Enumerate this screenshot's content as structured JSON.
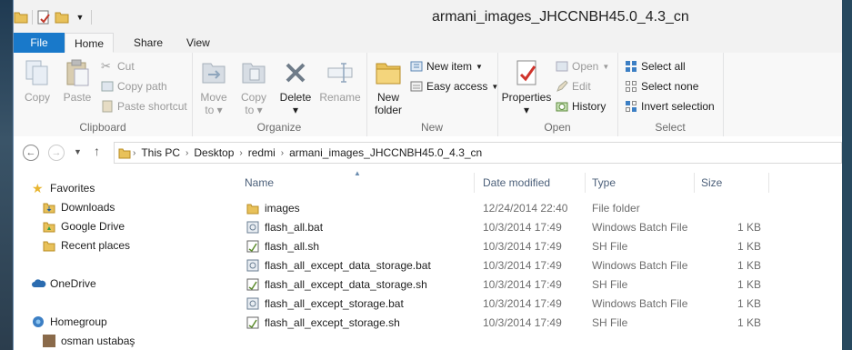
{
  "window": {
    "title": "armani_images_JHCCNBH45.0_4.3_cn"
  },
  "tabs": [
    "File",
    "Home",
    "Share",
    "View"
  ],
  "ribbon": {
    "clipboard": {
      "label": "Clipboard",
      "copy": "Copy",
      "paste": "Paste",
      "cut": "Cut",
      "copy_path": "Copy path",
      "paste_shortcut": "Paste shortcut"
    },
    "organize": {
      "label": "Organize",
      "move_to": "Move",
      "move_to_2": "to",
      "copy_to": "Copy",
      "copy_to_2": "to",
      "delete": "Delete",
      "rename": "Rename"
    },
    "new": {
      "label": "New",
      "new_folder": "New",
      "new_folder_2": "folder",
      "new_item": "New item",
      "easy_access": "Easy access"
    },
    "open": {
      "label": "Open",
      "properties": "Properties",
      "open": "Open",
      "edit": "Edit",
      "history": "History"
    },
    "select": {
      "label": "Select",
      "select_all": "Select all",
      "select_none": "Select none",
      "invert": "Invert selection"
    }
  },
  "address": {
    "crumbs": [
      "This PC",
      "Desktop",
      "redmi",
      "armani_images_JHCCNBH45.0_4.3_cn"
    ]
  },
  "nav": {
    "favorites": "Favorites",
    "downloads": "Downloads",
    "google_drive": "Google Drive",
    "recent": "Recent places",
    "onedrive": "OneDrive",
    "homegroup": "Homegroup",
    "user": "osman ustabaş"
  },
  "columns": {
    "name": "Name",
    "date": "Date modified",
    "type": "Type",
    "size": "Size"
  },
  "files": [
    {
      "name": "images",
      "date": "12/24/2014 22:40",
      "type": "File folder",
      "size": "",
      "icon": "folder-icon"
    },
    {
      "name": "flash_all.bat",
      "date": "10/3/2014 17:49",
      "type": "Windows Batch File",
      "size": "1 KB",
      "icon": "batch-file-icon"
    },
    {
      "name": "flash_all.sh",
      "date": "10/3/2014 17:49",
      "type": "SH File",
      "size": "1 KB",
      "icon": "sh-file-icon"
    },
    {
      "name": "flash_all_except_data_storage.bat",
      "date": "10/3/2014 17:49",
      "type": "Windows Batch File",
      "size": "1 KB",
      "icon": "batch-file-icon"
    },
    {
      "name": "flash_all_except_data_storage.sh",
      "date": "10/3/2014 17:49",
      "type": "SH File",
      "size": "1 KB",
      "icon": "sh-file-icon"
    },
    {
      "name": "flash_all_except_storage.bat",
      "date": "10/3/2014 17:49",
      "type": "Windows Batch File",
      "size": "1 KB",
      "icon": "batch-file-icon"
    },
    {
      "name": "flash_all_except_storage.sh",
      "date": "10/3/2014 17:49",
      "type": "SH File",
      "size": "1 KB",
      "icon": "sh-file-icon"
    }
  ],
  "colors": {
    "accent": "#1979ca",
    "folder": "#e8c15a"
  }
}
